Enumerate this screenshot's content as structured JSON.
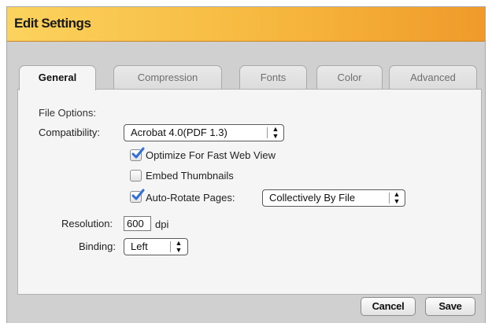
{
  "window": {
    "title": "Edit Settings"
  },
  "tabs": [
    {
      "label": "General",
      "active": true
    },
    {
      "label": "Compression",
      "active": false
    },
    {
      "label": "Fonts",
      "active": false
    },
    {
      "label": "Color",
      "active": false
    },
    {
      "label": "Advanced",
      "active": false
    }
  ],
  "general": {
    "file_options_heading": "File Options:",
    "compatibility_label": "Compatibility:",
    "compatibility_value": "Acrobat 4.0(PDF 1.3)",
    "optimize_label": "Optimize For Fast Web View",
    "optimize_checked": true,
    "embed_thumbnails_label": "Embed Thumbnails",
    "embed_thumbnails_checked": false,
    "auto_rotate_label": "Auto-Rotate Pages:",
    "auto_rotate_checked": true,
    "auto_rotate_value": "Collectively By File",
    "resolution_label": "Resolution:",
    "resolution_value": "600",
    "resolution_unit": "dpi",
    "binding_label": "Binding:",
    "binding_value": "Left"
  },
  "footer": {
    "cancel_label": "Cancel",
    "save_label": "Save"
  },
  "colors": {
    "titlebar_start": "#fbd35e",
    "titlebar_end": "#ef9a2a",
    "checkmark": "#2f6fd6"
  },
  "icons": {
    "popup_arrows": "up-down-arrows-icon",
    "check": "checkmark-icon"
  }
}
